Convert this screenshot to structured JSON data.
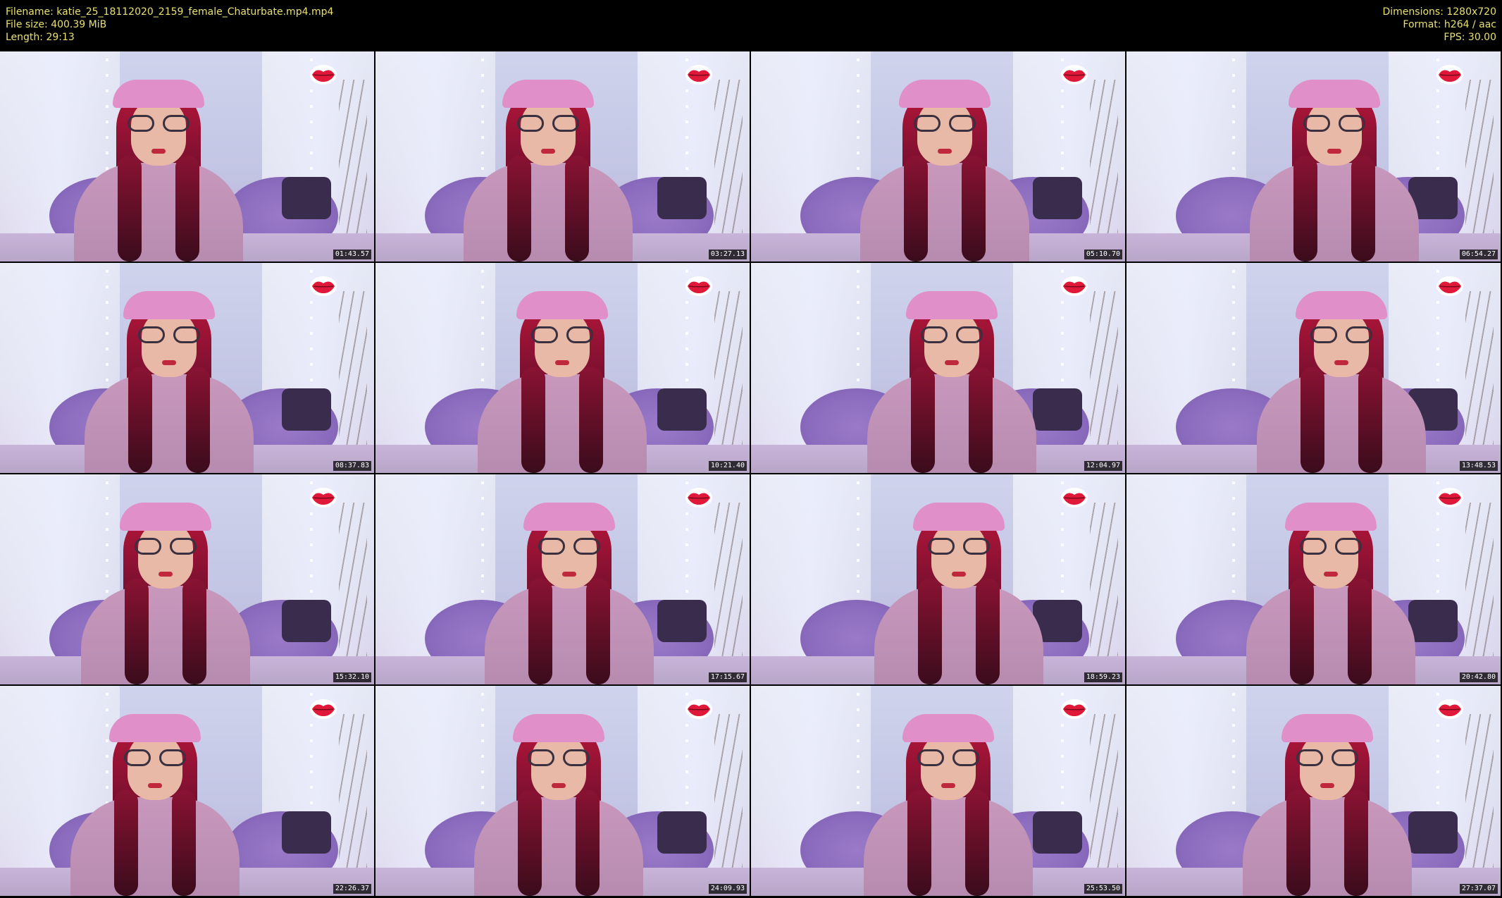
{
  "meta": {
    "filename": "Filename: katie_25_18112020_2159_female_Chaturbate.mp4.mp4",
    "filesize": "File size: 400.39 MiB",
    "length": "Length: 29:13",
    "dimensions": "Dimensions: 1280x720",
    "format": "Format: h264 / aac",
    "fps": "FPS: 30.00"
  },
  "icons": {
    "lips": "lips-icon"
  },
  "colors": {
    "meta_text": "#e8e070",
    "lips_red": "#e0183a",
    "background": "#000000"
  },
  "thumbnails": [
    {
      "timestamp": "01:43.57"
    },
    {
      "timestamp": "03:27.13"
    },
    {
      "timestamp": "05:10.70"
    },
    {
      "timestamp": "06:54.27"
    },
    {
      "timestamp": "08:37.83"
    },
    {
      "timestamp": "10:21.40"
    },
    {
      "timestamp": "12:04.97"
    },
    {
      "timestamp": "13:48.53"
    },
    {
      "timestamp": "15:32.10"
    },
    {
      "timestamp": "17:15.67"
    },
    {
      "timestamp": "18:59.23"
    },
    {
      "timestamp": "20:42.80"
    },
    {
      "timestamp": "22:26.37"
    },
    {
      "timestamp": "24:09.93"
    },
    {
      "timestamp": "25:53.50"
    },
    {
      "timestamp": "27:37.07"
    }
  ]
}
